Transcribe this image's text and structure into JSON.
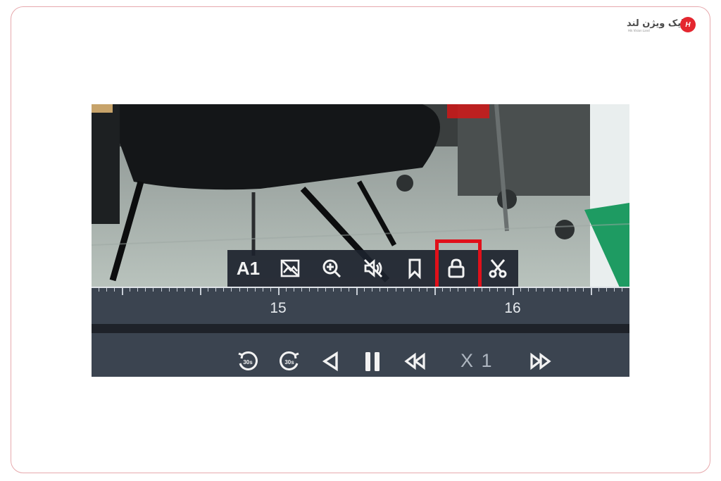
{
  "logo": {
    "text": "هایک ویژن لند",
    "subtitle": "Hik Vision Land",
    "badge": "H"
  },
  "toolbar": {
    "audio_channel_label": "A1",
    "items": [
      {
        "icon": "audio-channel"
      },
      {
        "icon": "image-off-icon"
      },
      {
        "icon": "zoom-in-icon"
      },
      {
        "icon": "mute-icon"
      },
      {
        "icon": "bookmark-icon"
      },
      {
        "icon": "lock-icon",
        "highlighted": true
      },
      {
        "icon": "scissors-icon"
      }
    ]
  },
  "timeline": {
    "labels": [
      "15",
      "16"
    ]
  },
  "controls": {
    "speed_label": "X 1",
    "buttons": [
      "rewind-30s-icon",
      "forward-30s-icon",
      "reverse-play-icon",
      "pause-icon",
      "slow-down-icon",
      "speed-up-icon"
    ]
  },
  "colors": {
    "highlight": "#e0101a",
    "toolbar_bg": "#1c222c",
    "timeline_bg": "#3b4450"
  }
}
